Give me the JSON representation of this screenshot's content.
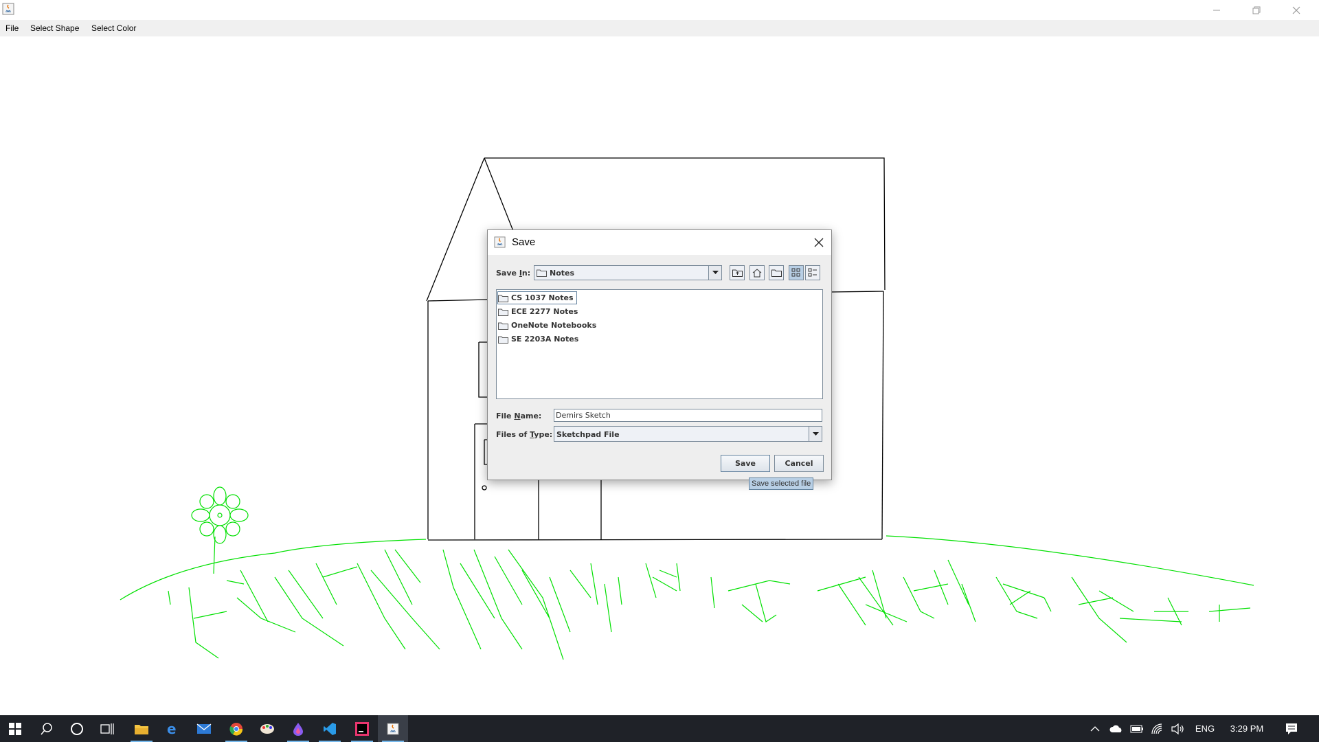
{
  "window": {
    "title": "",
    "menu": [
      "File",
      "Select Shape",
      "Select Color"
    ]
  },
  "canvas": {
    "house_color": "#000000",
    "grass_color": "#00e000",
    "flower_color": "#00e000"
  },
  "dialog": {
    "title": "Save",
    "save_in_label_pre": "Save ",
    "save_in_label_mn": "I",
    "save_in_label_post": "n:",
    "save_in_value": "Notes",
    "toolbar_icons": [
      "up-folder-icon",
      "home-icon",
      "new-folder-icon",
      "list-view-icon",
      "details-view-icon"
    ],
    "files": [
      {
        "name": "CS 1037 Notes",
        "selected": true
      },
      {
        "name": "ECE 2277 Notes",
        "selected": false
      },
      {
        "name": "OneNote Notebooks",
        "selected": false
      },
      {
        "name": "SE 2203A Notes",
        "selected": false
      }
    ],
    "file_name_label_pre": "File ",
    "file_name_label_mn": "N",
    "file_name_label_post": "ame:",
    "file_name_value": "Demirs Sketch",
    "file_type_label_pre": "Files of ",
    "file_type_label_mn": "T",
    "file_type_label_post": "ype:",
    "file_type_value": "Sketchpad File",
    "save_button": "Save",
    "cancel_button": "Cancel",
    "tooltip": "Save selected file"
  },
  "taskbar": {
    "apps": [
      "windows-start-icon",
      "search-icon",
      "cortana-icon",
      "task-view-icon",
      "file-explorer-icon",
      "edge-icon",
      "mail-icon",
      "chrome-icon",
      "paint-icon",
      "droplet-app-icon",
      "vscode-icon",
      "intellij-icon",
      "java-app-icon"
    ],
    "language": "ENG",
    "time": "3:29 PM"
  }
}
